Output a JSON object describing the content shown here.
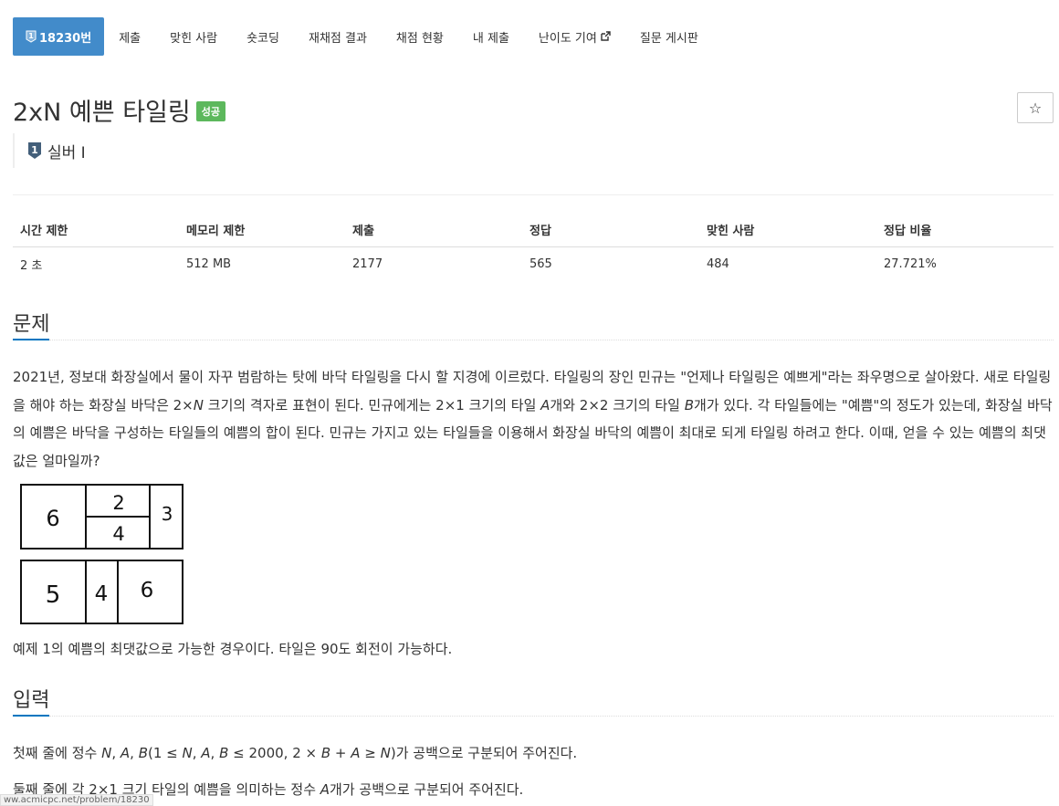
{
  "tabs": [
    {
      "label": "18230번",
      "active": true
    },
    {
      "label": "제출"
    },
    {
      "label": "맞힌 사람"
    },
    {
      "label": "숏코딩"
    },
    {
      "label": "재채점 결과"
    },
    {
      "label": "채점 현황"
    },
    {
      "label": "내 제출"
    },
    {
      "label": "난이도 기여"
    },
    {
      "label": "질문 게시판"
    }
  ],
  "problem": {
    "title": "2xN 예쁜 타일링",
    "status_badge": "성공",
    "tier": "실버 I",
    "star_icon": "☆"
  },
  "info_table": {
    "headers": [
      "시간 제한",
      "메모리 제한",
      "제출",
      "정답",
      "맞힌 사람",
      "정답 비율"
    ],
    "values": [
      "2 초",
      "512 MB",
      "2177",
      "565",
      "484",
      "27.721%"
    ]
  },
  "sections": {
    "problem_heading": "문제",
    "input_heading": "입력"
  },
  "figure": {
    "top_row": [
      "6",
      "2",
      "4",
      "3"
    ],
    "bottom_row": [
      "5",
      "4",
      "6"
    ]
  },
  "figure_caption": "예제 1의 예쁨의 최댓값으로 가능한 경우이다. 타일은 90도 회전이 가능하다.",
  "status_url": "ww.acmicpc.net/problem/18230",
  "colors": {
    "accent": "#428bca",
    "success": "#5cb85c",
    "underline": "#0076c0"
  }
}
